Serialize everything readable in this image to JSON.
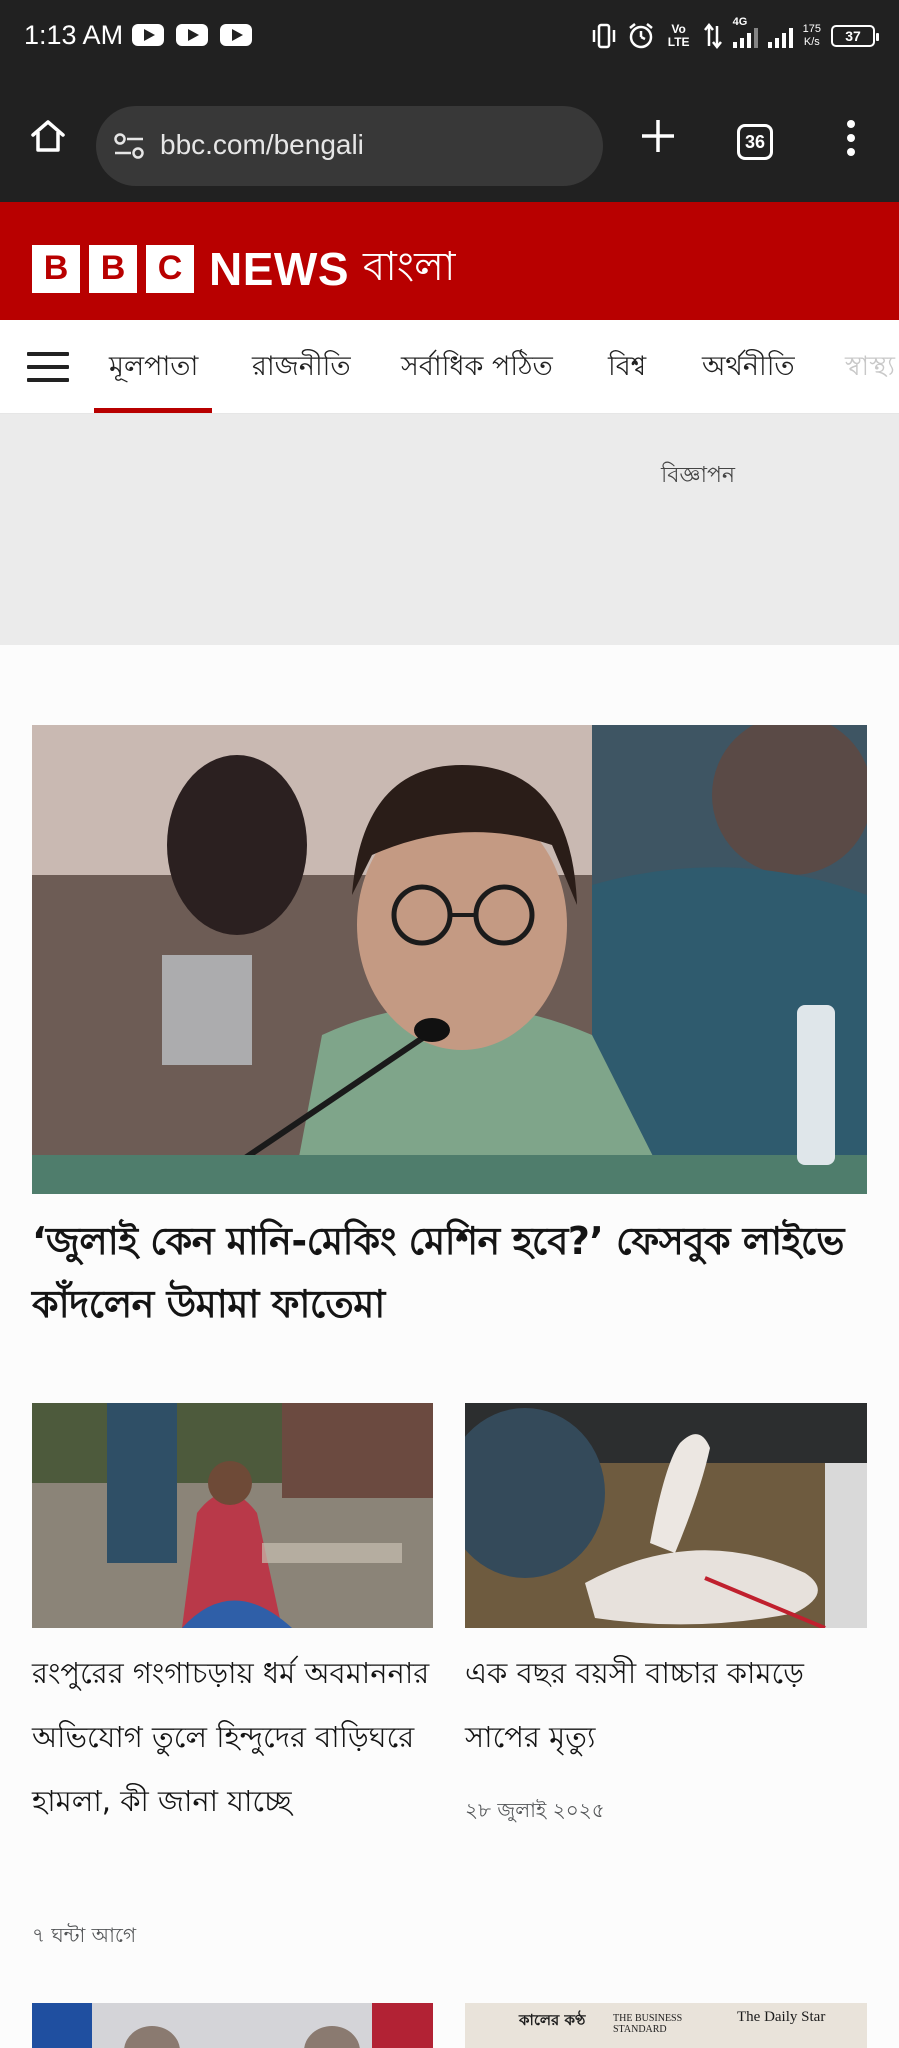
{
  "status_bar": {
    "time": "1:13 AM",
    "network_type": "4G",
    "volte": "Vo LTE",
    "speed_value": "175",
    "speed_unit": "K/s",
    "battery": "37"
  },
  "browser": {
    "url": "bbc.com/bengali",
    "tab_count": "36"
  },
  "site": {
    "logo_letters": [
      "B",
      "B",
      "C"
    ],
    "news_word": "NEWS",
    "language_word": "বাংলা",
    "brand_color": "#b80000"
  },
  "nav": {
    "items": [
      "মূলপাতা",
      "রাজনীতি",
      "সর্বাধিক পঠিত",
      "বিশ্ব",
      "অর্থনীতি",
      "স্বাস্থ্য"
    ],
    "active_index": 0
  },
  "ad": {
    "label": "বিজ্ঞাপন"
  },
  "top_story": {
    "headline": "‘জুলাই কেন মানি-মেকিং মেশিন হবে?’ ফেসবুক লাইভে কাঁদলেন উমামা ফাতেমা"
  },
  "stories": [
    {
      "title": "রংপুরের গংগাচড়ায় ধর্ম অবমাননার অভিযোগ তুলে হিন্দুদের বাড়িঘরে হামলা, কী জানা যাচ্ছে",
      "meta": "৭ ঘন্টা আগে"
    },
    {
      "title": "এক বছর বয়সী বাচ্চার কামড়ে সাপের মৃত্যু",
      "meta": "২৮ জুলাই ২০২৫"
    }
  ],
  "partial_thumbnails": {
    "right_texts": [
      "কালের কণ্ঠ",
      "THE BUSINESS STANDARD",
      "The Daily Star"
    ]
  }
}
